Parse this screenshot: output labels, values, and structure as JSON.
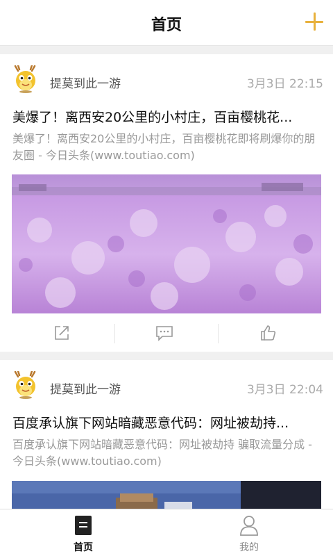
{
  "header": {
    "title": "首页",
    "add_icon": "plus-icon",
    "accent": "#e8b13c"
  },
  "feed": [
    {
      "author": "提莫到此一游",
      "time": "3月3日 22:15",
      "headline": "美爆了！离西安20公里的小村庄，百亩樱桃花...",
      "summary": "美爆了！离西安20公里的小村庄，百亩樱桃花即将刷爆你的朋友圈 - 今日头条(www.toutiao.com)",
      "actions": {
        "share_icon": "share-icon",
        "comment_icon": "comment-icon",
        "like_icon": "like-icon"
      }
    },
    {
      "author": "提莫到此一游",
      "time": "3月3日 22:04",
      "headline": "百度承认旗下网站暗藏恶意代码：网址被劫持...",
      "summary": "百度承认旗下网站暗藏恶意代码：网址被劫持 骗取流量分成 - 今日头条(www.toutiao.com)"
    }
  ],
  "tabbar": {
    "home_label": "首页",
    "mine_label": "我的",
    "home_icon": "home-tab-icon",
    "mine_icon": "user-icon"
  }
}
